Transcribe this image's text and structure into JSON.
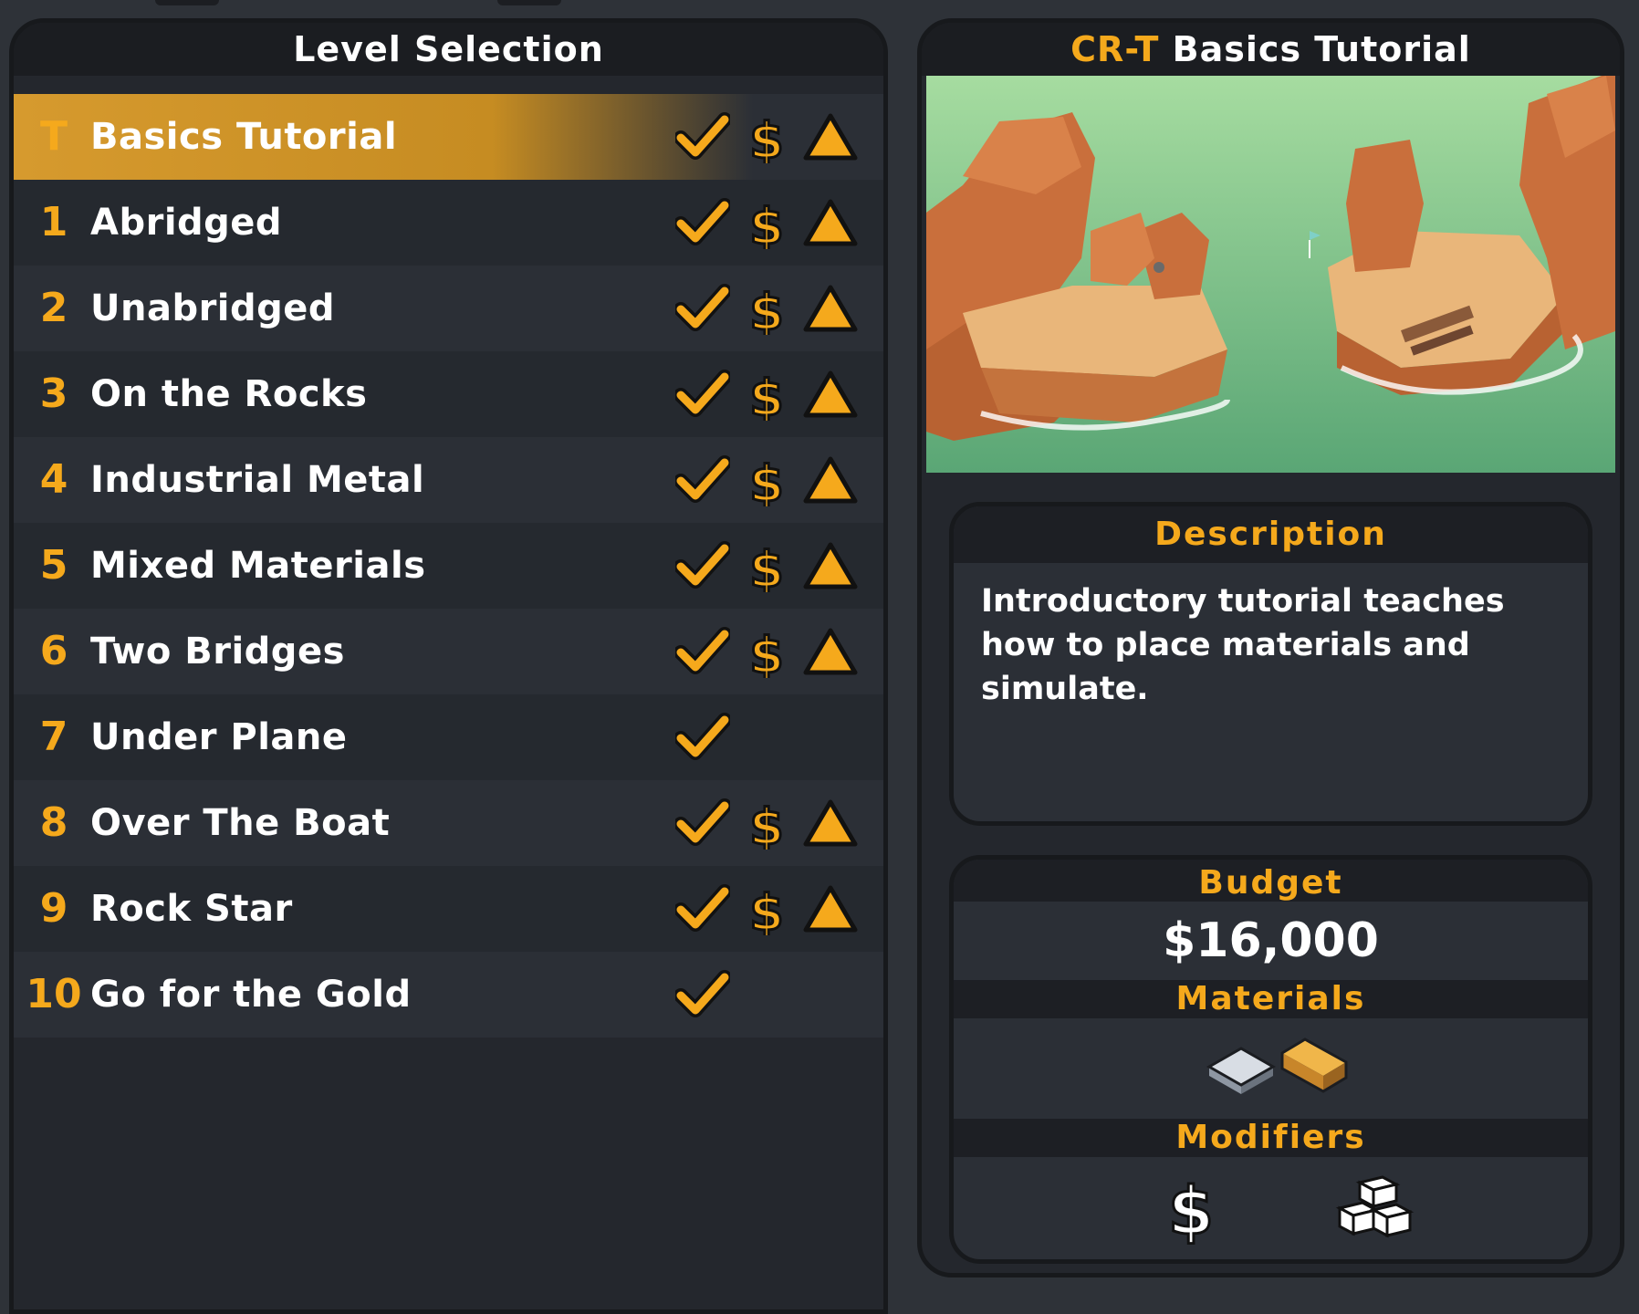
{
  "left_panel": {
    "title": "Level Selection",
    "levels": [
      {
        "num": "T",
        "name": "Basics Tutorial",
        "selected": true,
        "icons": [
          "check-icon",
          "dollar-icon",
          "warning-icon"
        ]
      },
      {
        "num": "1",
        "name": "Abridged",
        "icons": [
          "check-icon",
          "dollar-icon",
          "warning-icon"
        ]
      },
      {
        "num": "2",
        "name": "Unabridged",
        "icons": [
          "check-icon",
          "dollar-icon",
          "warning-icon"
        ]
      },
      {
        "num": "3",
        "name": "On the Rocks",
        "icons": [
          "check-icon",
          "dollar-icon",
          "warning-icon"
        ]
      },
      {
        "num": "4",
        "name": "Industrial Metal",
        "icons": [
          "check-icon",
          "dollar-icon",
          "warning-icon"
        ]
      },
      {
        "num": "5",
        "name": "Mixed Materials",
        "icons": [
          "check-icon",
          "dollar-icon",
          "warning-icon"
        ]
      },
      {
        "num": "6",
        "name": "Two Bridges",
        "icons": [
          "check-icon",
          "dollar-icon",
          "warning-icon"
        ]
      },
      {
        "num": "7",
        "name": "Under Plane",
        "icons": [
          "check-icon"
        ]
      },
      {
        "num": "8",
        "name": "Over The Boat",
        "icons": [
          "check-icon",
          "dollar-icon",
          "warning-icon"
        ]
      },
      {
        "num": "9",
        "name": "Rock Star",
        "icons": [
          "check-icon",
          "dollar-icon",
          "warning-icon"
        ]
      },
      {
        "num": "10",
        "name": "Go for the Gold",
        "icons": [
          "check-icon"
        ]
      }
    ]
  },
  "right_panel": {
    "level_code": "CR-T",
    "level_title": "Basics Tutorial",
    "description_title": "Description",
    "description": "Introductory tutorial teaches how to place materials and simulate.",
    "budget_title": "Budget",
    "budget_value": "$16,000",
    "materials_title": "Materials",
    "materials": [
      "steel-beam-icon",
      "wood-beam-icon"
    ],
    "modifiers_title": "Modifiers",
    "modifiers": [
      "dollar-modifier-icon",
      "blocks-modifier-icon"
    ]
  },
  "colors": {
    "accent": "#f5a91c",
    "panel_bg": "#24272d",
    "header_bg": "#1b1d21",
    "selected_row": "#d69a2e"
  }
}
